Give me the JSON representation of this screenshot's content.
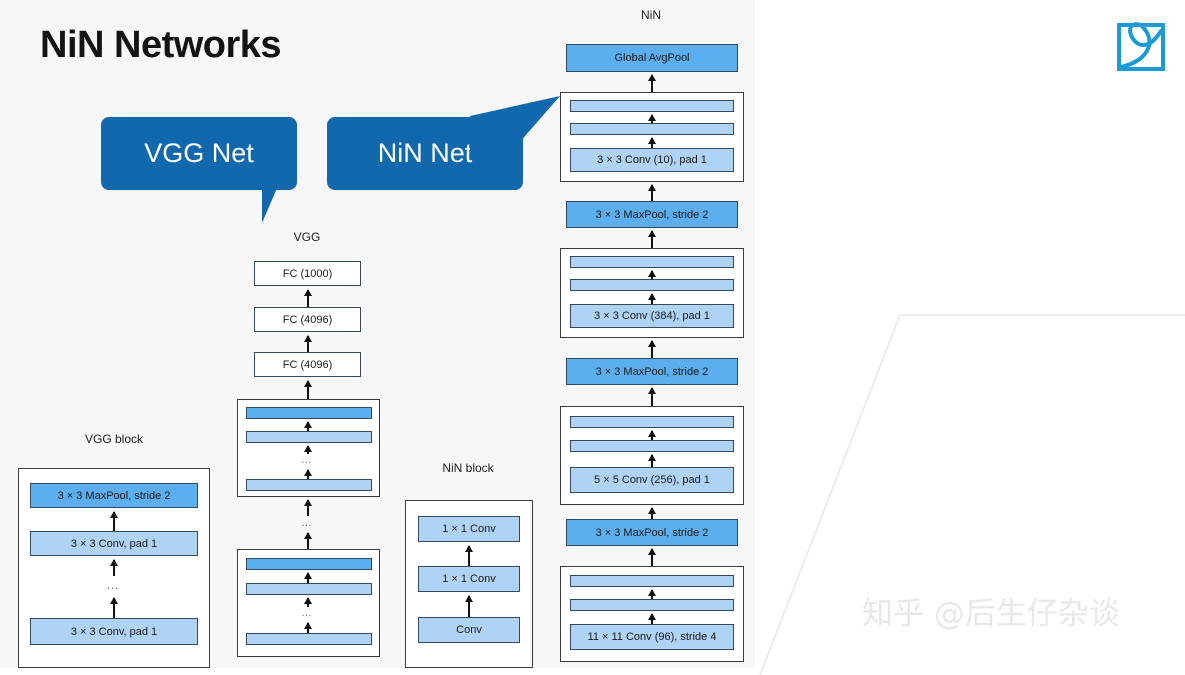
{
  "slide": {
    "title": "NiN Networks",
    "background_color": "#f7f7f7",
    "accent_color": "#1268ac",
    "node_light_color": "#aed3f4",
    "node_medium_color": "#5cafee"
  },
  "callouts": [
    {
      "id": "vgg",
      "label": "VGG Net"
    },
    {
      "id": "nin",
      "label": "NiN Net"
    }
  ],
  "captions": {
    "vgg_net": "VGG",
    "nin_net": "NiN",
    "vgg_block": "VGG block",
    "nin_block": "NiN block"
  },
  "vgg_block": {
    "nodes": [
      {
        "label": "3 × 3 MaxPool, stride 2",
        "shade": "medium"
      },
      {
        "label": "3 × 3 Conv, pad 1",
        "shade": "light"
      },
      {
        "label": "…",
        "shade": "ellipsis"
      },
      {
        "label": "3 × 3 Conv, pad 1",
        "shade": "light"
      }
    ]
  },
  "nin_block": {
    "nodes": [
      {
        "label": "1 × 1 Conv",
        "shade": "light"
      },
      {
        "label": "1 × 1 Conv",
        "shade": "light"
      },
      {
        "label": "Conv",
        "shade": "light"
      }
    ]
  },
  "vgg_net": {
    "nodes": [
      {
        "label": "FC (1000)",
        "shade": "plain"
      },
      {
        "label": "FC (4096)",
        "shade": "plain"
      },
      {
        "label": "FC (4096)",
        "shade": "plain"
      }
    ],
    "blocks": [
      {
        "bars": [
          "medium",
          "light",
          "ellipsis",
          "light"
        ]
      },
      {
        "bars": [
          "medium",
          "light",
          "ellipsis",
          "light"
        ]
      }
    ],
    "block_separator": "…"
  },
  "nin_net": {
    "stack": [
      {
        "kind": "node",
        "label": "Global AvgPool",
        "shade": "medium"
      },
      {
        "kind": "block",
        "label": "3 × 3 Conv (10), pad 1",
        "shade": "light"
      },
      {
        "kind": "node",
        "label": "3 × 3 MaxPool, stride 2",
        "shade": "medium"
      },
      {
        "kind": "block",
        "label": "3 × 3 Conv (384), pad 1",
        "shade": "light"
      },
      {
        "kind": "node",
        "label": "3 × 3 MaxPool, stride 2",
        "shade": "medium"
      },
      {
        "kind": "block",
        "label": "5 × 5 Conv (256), pad 1",
        "shade": "light"
      },
      {
        "kind": "node",
        "label": "3 × 3 MaxPool, stride 2",
        "shade": "medium"
      },
      {
        "kind": "block",
        "label": "11 × 11 Conv (96), stride 4",
        "shade": "light"
      }
    ]
  },
  "watermark": {
    "text": "知乎 @后生仔杂谈"
  },
  "logo": {
    "name": "zhihu-logo",
    "color": "#1a9ad7"
  }
}
